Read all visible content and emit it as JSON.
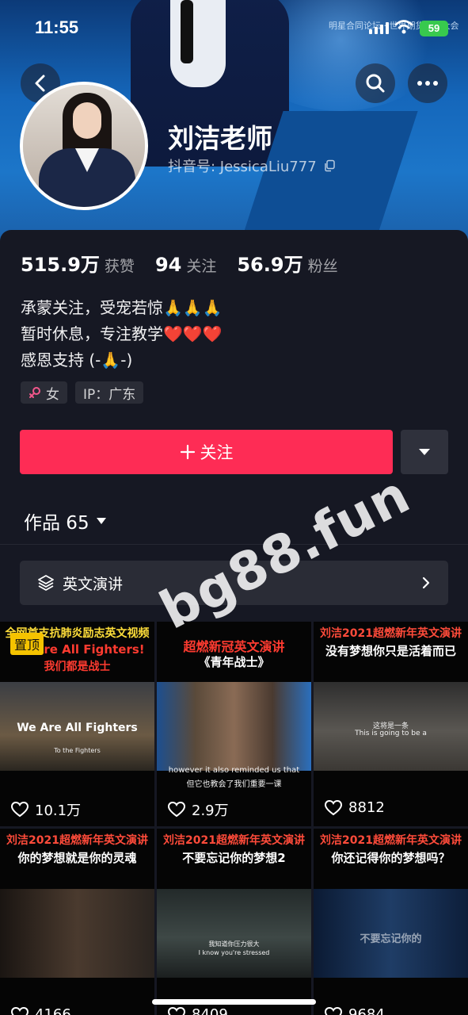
{
  "status_bar": {
    "time": "11:55",
    "battery": "59"
  },
  "header": {
    "banner_text": "明星合同论坛 · 世界期货论坛大会",
    "profile_name": "刘洁老师",
    "douyin_id": "抖音号: JessicaLiu777"
  },
  "stats": {
    "likes_num": "515.9万",
    "likes_label": "获赞",
    "following_num": "94",
    "following_label": "关注",
    "followers_num": "56.9万",
    "followers_label": "粉丝"
  },
  "bio": {
    "line1": "承蒙关注，受宠若惊🙏🙏🙏",
    "line2": "暂时休息，专注教学❤️❤️❤️",
    "line3": "感恩支持 (-🙏-)"
  },
  "tags": {
    "gender": "女",
    "ip": "IP：广东"
  },
  "follow_button": {
    "label": "关注"
  },
  "works": {
    "label": "作品 65"
  },
  "collection": {
    "label": "英文演讲"
  },
  "videos": [
    {
      "pinned": "置顶",
      "title1": "全网首支抗肺炎励志英文视频",
      "title2": "We Are All Fighters!",
      "title3": "我们都是战士",
      "caption1": "We Are All Fighters",
      "caption2": "To the Fighters",
      "likes": "10.1万"
    },
    {
      "title1": "超燃新冠英文演讲",
      "title2": "《青年战士》",
      "caption1": "however it also reminded us that",
      "caption2": "但它也教会了我们重要一课",
      "likes": "2.9万"
    },
    {
      "title1": "刘洁2021超燃新年英文演讲",
      "title2": "没有梦想你只是活着而已",
      "caption1": "这将是一条",
      "caption2": "This is going to be a",
      "likes": "8812"
    },
    {
      "title1": "刘洁2021超燃新年英文演讲",
      "title2": "你的梦想就是你的灵魂",
      "likes": "4166"
    },
    {
      "title1": "刘洁2021超燃新年英文演讲",
      "title2": "不要忘记你的梦想2",
      "caption1": "我知道你压力很大",
      "caption2": "I know you're stressed",
      "likes": "8409"
    },
    {
      "title1": "刘洁2021超燃新年英文演讲",
      "title2": "你还记得你的梦想吗？",
      "caption1": "不要忘记你的",
      "likes": "9684"
    }
  ],
  "watermark": "bg88.fun"
}
